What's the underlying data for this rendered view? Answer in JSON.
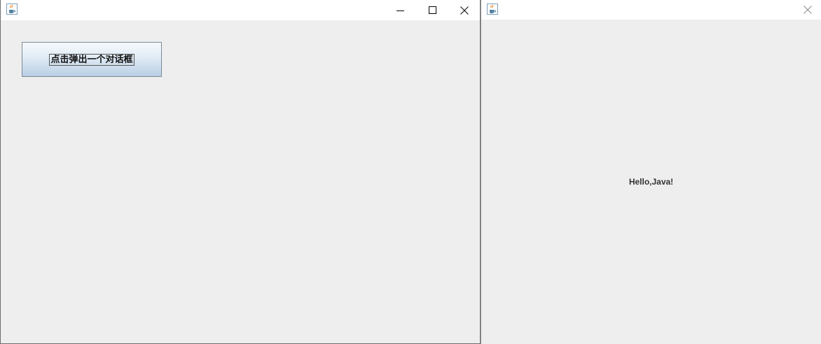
{
  "main_window": {
    "button_label": "点击弹出一个对话框",
    "controls": [
      "minimize-icon",
      "maximize-icon",
      "close-icon"
    ]
  },
  "dialog_window": {
    "message": "Hello,Java!",
    "controls": [
      "close-icon"
    ]
  },
  "icons": {
    "app_icon": "java-cup-icon"
  },
  "colors": {
    "titlebar_bg": "#ffffff",
    "client_bg": "#eeeeee",
    "button_gradient_top": "#f6f9fc",
    "button_gradient_bottom": "#b8cfe5"
  }
}
